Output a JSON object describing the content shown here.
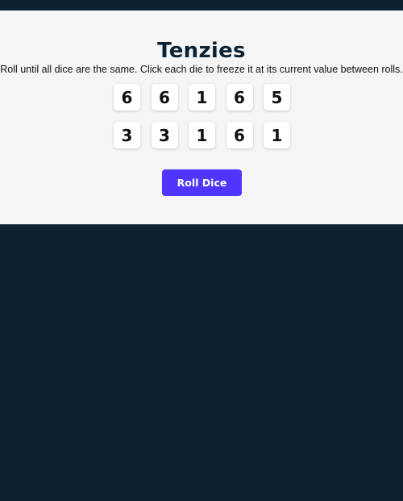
{
  "app": {
    "title": "Tenzies",
    "instructions": "Roll until all dice are the same. Click each die to freeze it at its current value between rolls."
  },
  "dice": [
    {
      "value": "6"
    },
    {
      "value": "6"
    },
    {
      "value": "1"
    },
    {
      "value": "6"
    },
    {
      "value": "5"
    },
    {
      "value": "3"
    },
    {
      "value": "3"
    },
    {
      "value": "1"
    },
    {
      "value": "6"
    },
    {
      "value": "1"
    }
  ],
  "controls": {
    "roll_label": "Roll Dice"
  },
  "colors": {
    "background": "#0b2234",
    "panel": "#f5f5f5",
    "accent": "#5035ff",
    "die_face": "#ffffff"
  }
}
